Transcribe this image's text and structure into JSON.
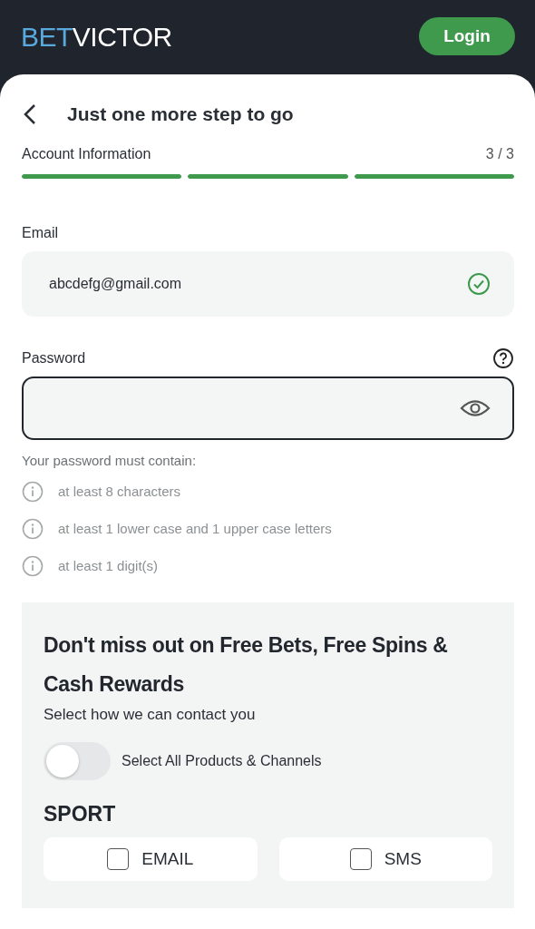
{
  "header": {
    "logo": {
      "part_1": "BET",
      "part_2": "VICTOR"
    },
    "login_button": "Login"
  },
  "title": "Just one more step to go",
  "progress": {
    "label": "Account Information",
    "count": "3 / 3",
    "segments": [
      {
        "level": 1
      },
      {
        "level": 1
      },
      {
        "level": 1
      }
    ]
  },
  "email": {
    "label": "Email",
    "value": "abcdefg@gmail.com",
    "valid": true
  },
  "password": {
    "label": "Password",
    "focused": true,
    "hint": "Your password must contain:",
    "requirements": [
      {
        "text": "at least 8 characters",
        "met": false
      },
      {
        "text": "at least 1 lower case and 1 upper case letters",
        "met": false
      },
      {
        "text": "at least 1 digit(s)",
        "met": false
      }
    ]
  },
  "promo": {
    "heading": "Don't miss out on Free Bets, Free Spins & Cash Rewards",
    "subtitle": "Select how we can contact you",
    "select_all": {
      "label": "Select All Products & Channels",
      "on": false
    },
    "sections": [
      {
        "title": "SPORT",
        "channels": [
          {
            "label": "EMAIL",
            "checked": false
          },
          {
            "label": "SMS",
            "checked": false
          }
        ]
      }
    ]
  }
}
